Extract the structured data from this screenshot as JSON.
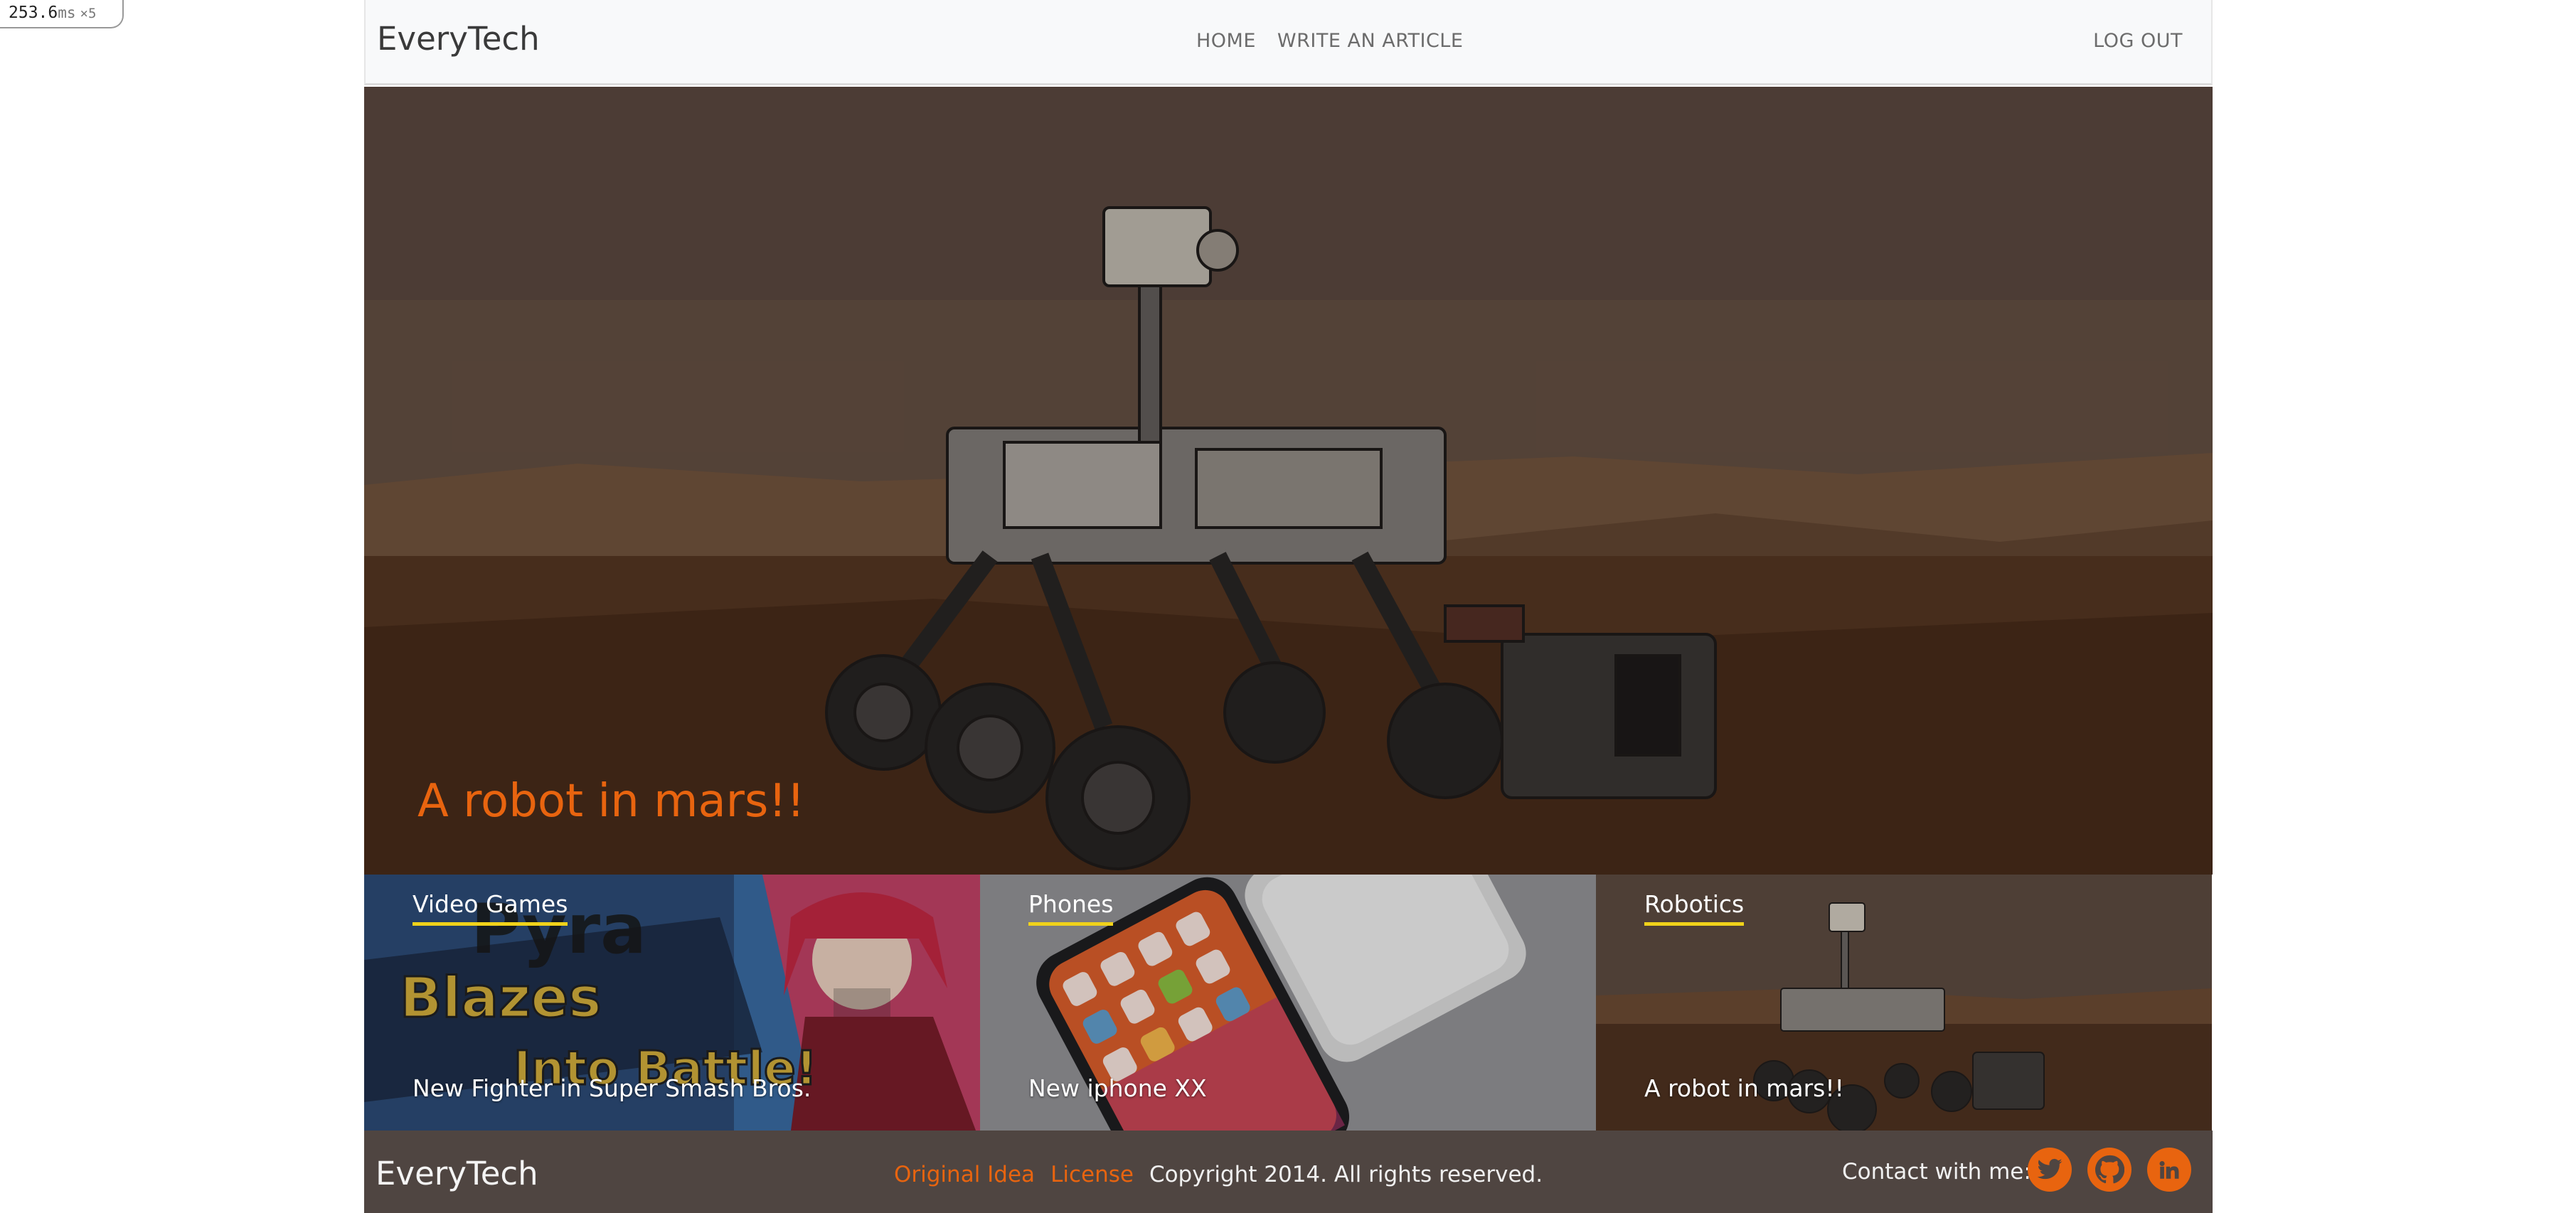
{
  "perf": {
    "value": "253.6",
    "unit": "ms",
    "multiplier": "×5"
  },
  "navbar": {
    "brand": "EveryTech",
    "links": [
      "HOME",
      "WRITE AN ARTICLE"
    ],
    "logout": "LOG OUT"
  },
  "hero": {
    "title": "A robot in mars!!"
  },
  "cards": [
    {
      "category": "Video Games",
      "title": "New Fighter in Super Smash Bros.",
      "image_text": [
        "Pyra",
        "Blazes",
        "Into Battle!"
      ]
    },
    {
      "category": "Phones",
      "title": "New iphone XX"
    },
    {
      "category": "Robotics",
      "title": "A robot in mars!!"
    }
  ],
  "footer": {
    "brand": "EveryTech",
    "links": [
      "Original Idea",
      "License"
    ],
    "copyright": "Copyright 2014. All rights reserved.",
    "contact_label": "Contact with me:",
    "social_icons": [
      "twitter-icon",
      "github-icon",
      "linkedin-icon"
    ]
  },
  "colors": {
    "accent": "#e8640f",
    "underline": "#f0d21a",
    "footer_bg": "#4f4541"
  }
}
